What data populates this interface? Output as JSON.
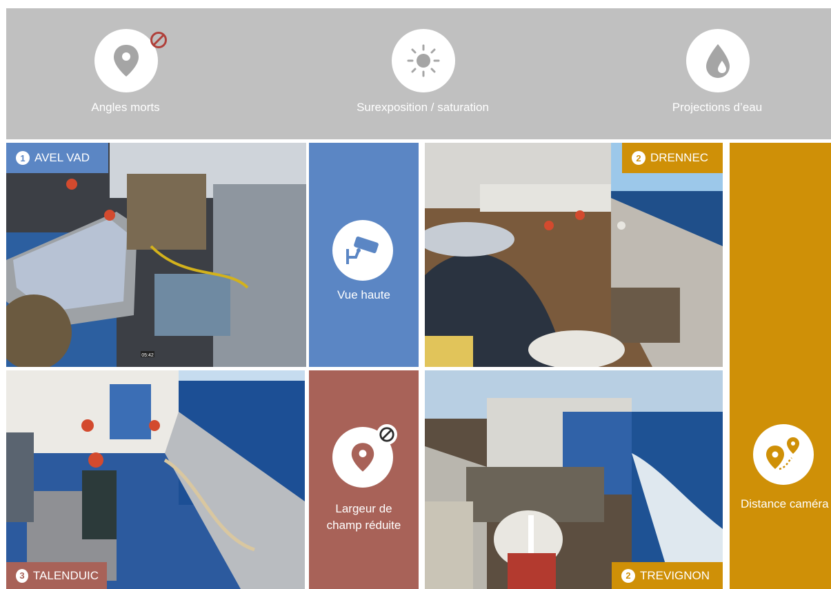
{
  "banner": {
    "issues": [
      {
        "label": "Angles morts",
        "icon": "location-pin-banned-icon"
      },
      {
        "label": "Surexposition / saturation",
        "icon": "sun-icon"
      },
      {
        "label": "Projections d’eau",
        "icon": "water-drop-icon"
      }
    ]
  },
  "cameras": [
    {
      "number": "1",
      "name": "AVEL VAD",
      "color": "#5b86c4"
    },
    {
      "number": "2",
      "name": "DRENNEC",
      "color": "#cf9007"
    },
    {
      "number": "3",
      "name": "TALENDUIC",
      "color": "#a86258"
    },
    {
      "number": "2",
      "name": "TREVIGNON",
      "color": "#cf9007"
    }
  ],
  "panels": {
    "top_view": {
      "label": "Vue haute",
      "icon": "security-camera-icon",
      "color": "#5b86c4"
    },
    "narrow_field": {
      "label_line1": "Largeur de",
      "label_line2": "champ réduite",
      "icon": "location-pin-banned-icon",
      "color": "#a86258"
    },
    "camera_distance": {
      "label": "Distance caméra",
      "icon": "route-pins-icon",
      "color": "#cf9007"
    }
  },
  "photo_overlay": {
    "timestamp": "05:42"
  }
}
